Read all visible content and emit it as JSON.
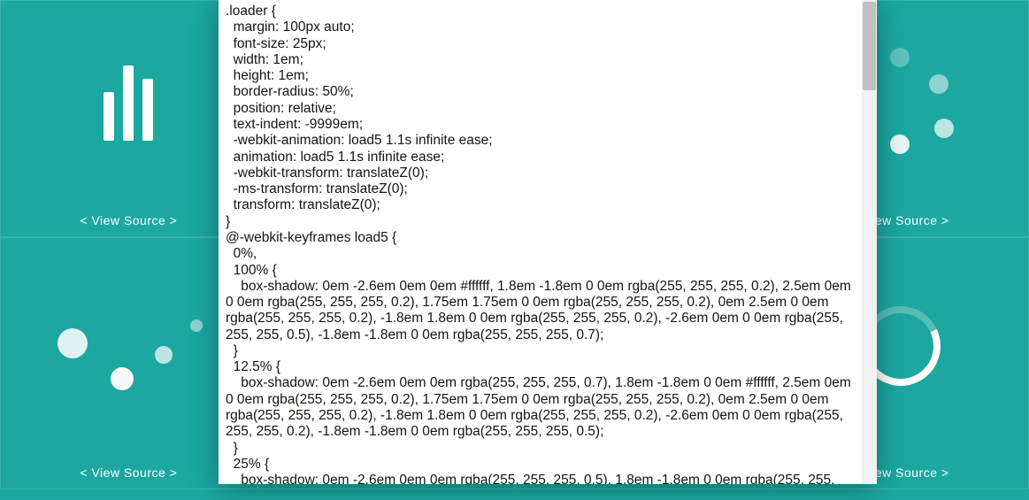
{
  "view_source_label": "< View Source >",
  "tiles": [
    {
      "id": "bars"
    },
    {
      "id": "hidden-under-modal-top"
    },
    {
      "id": "hidden-under-modal-top-2"
    },
    {
      "id": "orbit"
    },
    {
      "id": "bouncing-dots"
    },
    {
      "id": "growing-bars"
    },
    {
      "id": "hidden-under-modal-bottom"
    },
    {
      "id": "arc-ring"
    }
  ],
  "source_code": ".loader {\n  margin: 100px auto;\n  font-size: 25px;\n  width: 1em;\n  height: 1em;\n  border-radius: 50%;\n  position: relative;\n  text-indent: -9999em;\n  -webkit-animation: load5 1.1s infinite ease;\n  animation: load5 1.1s infinite ease;\n  -webkit-transform: translateZ(0);\n  -ms-transform: translateZ(0);\n  transform: translateZ(0);\n}\n@-webkit-keyframes load5 {\n  0%,\n  100% {\n    box-shadow: 0em -2.6em 0em 0em #ffffff, 1.8em -1.8em 0 0em rgba(255, 255, 255, 0.2), 2.5em 0em 0 0em rgba(255, 255, 255, 0.2), 1.75em 1.75em 0 0em rgba(255, 255, 255, 0.2), 0em 2.5em 0 0em rgba(255, 255, 255, 0.2), -1.8em 1.8em 0 0em rgba(255, 255, 255, 0.2), -2.6em 0em 0 0em rgba(255, 255, 255, 0.5), -1.8em -1.8em 0 0em rgba(255, 255, 255, 0.7);\n  }\n  12.5% {\n    box-shadow: 0em -2.6em 0em 0em rgba(255, 255, 255, 0.7), 1.8em -1.8em 0 0em #ffffff, 2.5em 0em 0 0em rgba(255, 255, 255, 0.2), 1.75em 1.75em 0 0em rgba(255, 255, 255, 0.2), 0em 2.5em 0 0em rgba(255, 255, 255, 0.2), -1.8em 1.8em 0 0em rgba(255, 255, 255, 0.2), -2.6em 0em 0 0em rgba(255, 255, 255, 0.2), -1.8em -1.8em 0 0em rgba(255, 255, 255, 0.5);\n  }\n  25% {\n    box-shadow: 0em -2.6em 0em 0em rgba(255, 255, 255, 0.5), 1.8em -1.8em 0 0em rgba(255, 255,"
}
